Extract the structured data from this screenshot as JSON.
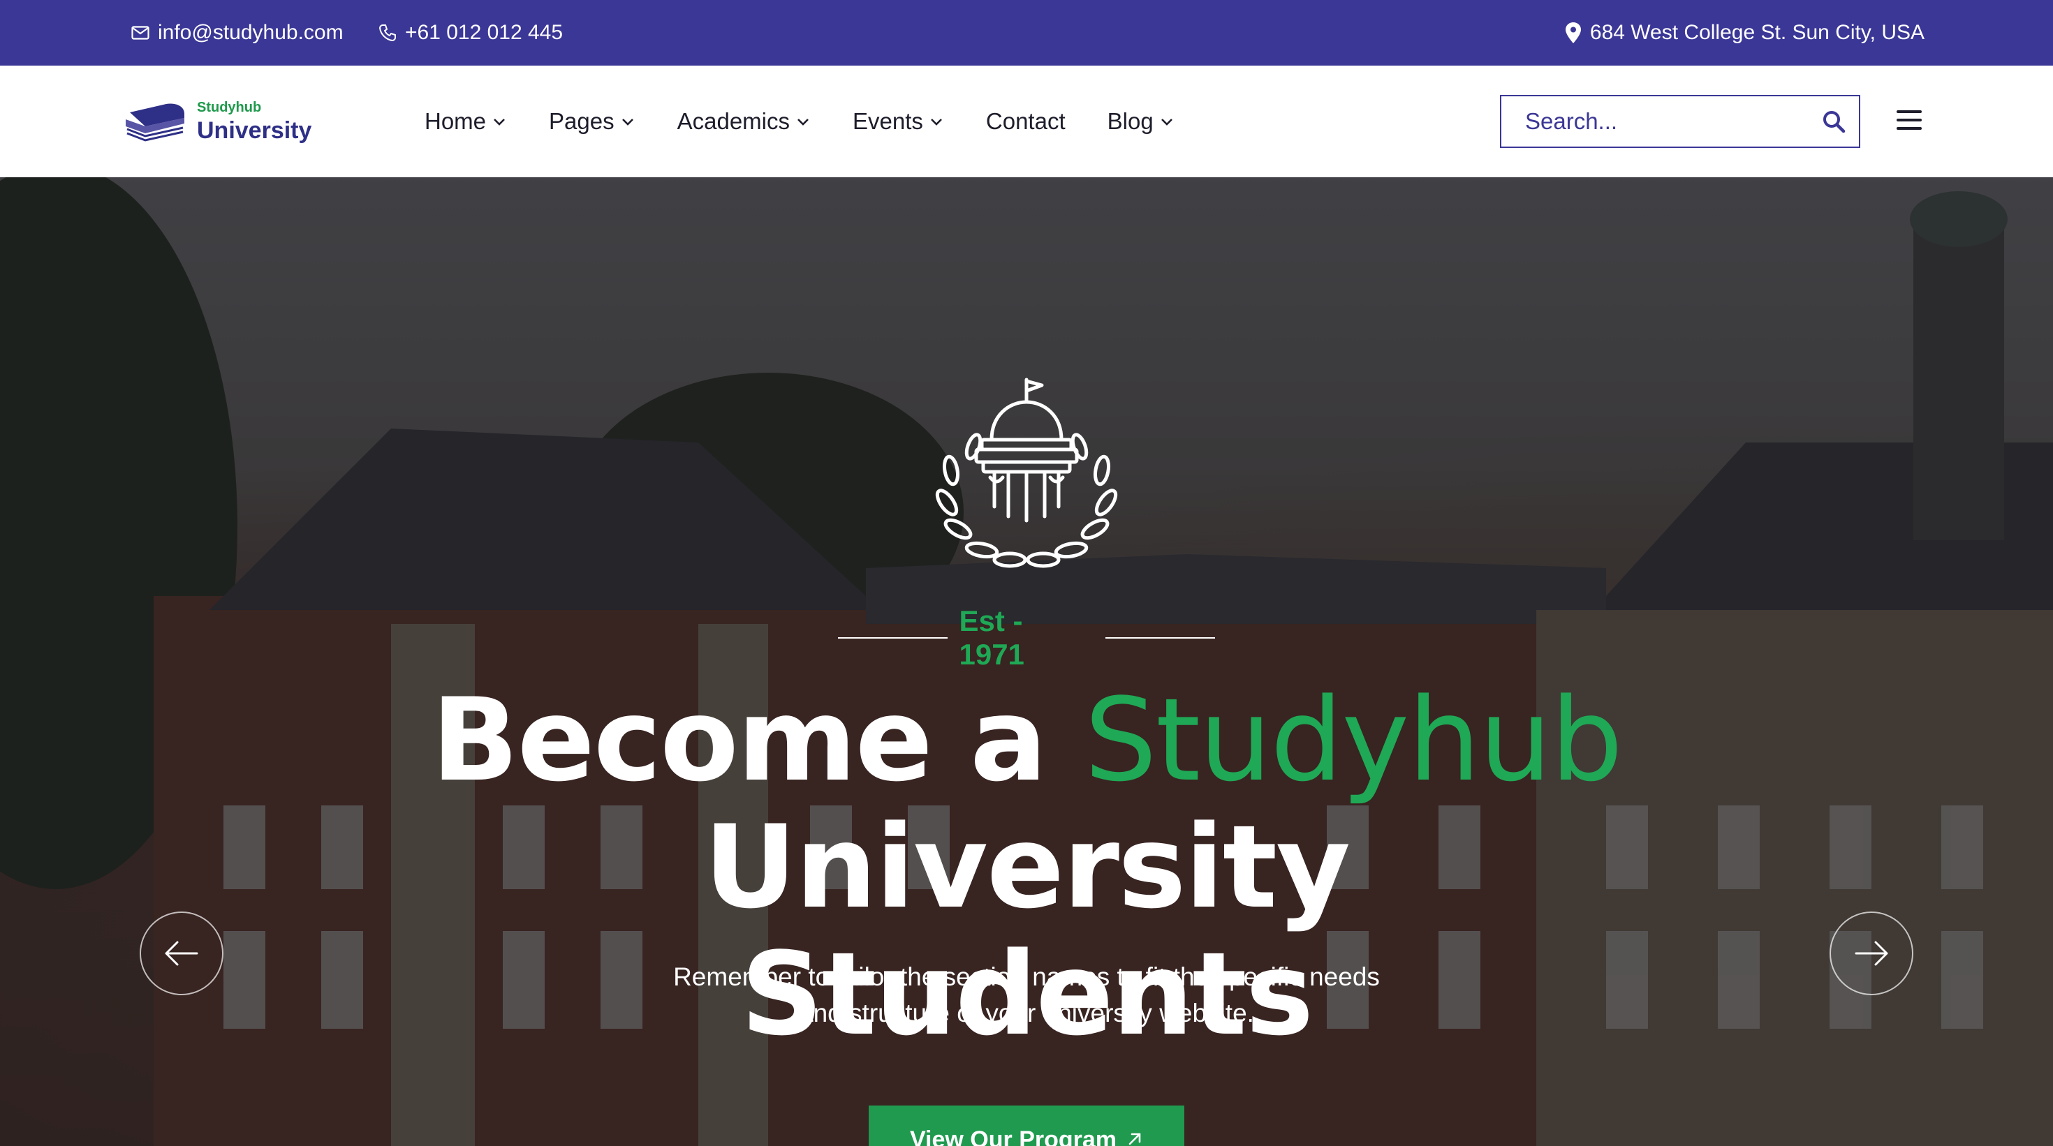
{
  "topbar": {
    "email": "info@studyhub.com",
    "phone": "+61 012 012 445",
    "address": "684 West College St. Sun City, USA"
  },
  "logo": {
    "small": "Studyhub",
    "big": "University"
  },
  "nav": {
    "items": [
      {
        "label": "Home",
        "dropdown": true
      },
      {
        "label": "Pages",
        "dropdown": true
      },
      {
        "label": "Academics",
        "dropdown": true
      },
      {
        "label": "Events",
        "dropdown": true
      },
      {
        "label": "Contact",
        "dropdown": false
      },
      {
        "label": "Blog",
        "dropdown": true
      }
    ]
  },
  "search": {
    "placeholder": "Search..."
  },
  "hero": {
    "est": "Est - 1971",
    "headline_part1": "Become a ",
    "headline_accent": "Studyhub",
    "headline_line2": "University Students",
    "subtitle_line1": "Remember to tailor the section names to fit the specific needs",
    "subtitle_line2": "and structure of your university website.",
    "cta_label": "View Our Program"
  },
  "icons": {
    "topbar": [
      "mail-icon",
      "phone-icon",
      "location-pin-icon"
    ],
    "header": [
      "chevron-down-icon",
      "search-icon",
      "hamburger-menu-icon"
    ],
    "hero": [
      "university-emblem-icon",
      "arrow-left-icon",
      "arrow-right-icon",
      "arrow-up-right-icon"
    ]
  },
  "colors": {
    "topbar_bg": "#3b3796",
    "brand_navy": "#2e2f86",
    "accent_green": "#1fa855",
    "cta_green": "#1f9a4f"
  }
}
